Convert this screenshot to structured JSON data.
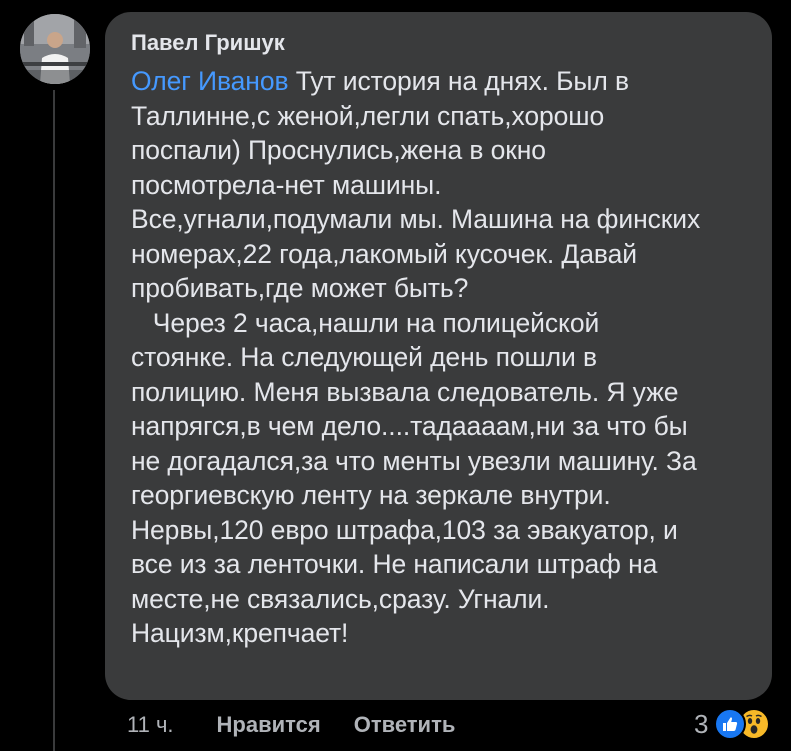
{
  "comment": {
    "author": "Павел Гришук",
    "mention": "Олег Иванов",
    "lines": [
      " Тут история на днях. Был в",
      "Таллинне,с женой,легли спать,хорошо",
      "поспали) Проснулись,жена в окно",
      "посмотрела-нет машины.",
      "Все,угнали,подумали мы. Машина на финских",
      "номерах,22 года,лакомый кусочек. Давай",
      "пробивать,где может быть?",
      "   Через 2 часа,нашли на полицейской",
      "стоянке. На следующей день пошли в",
      "полицию. Меня вызвала следователь. Я уже",
      "напрягся,в чем дело....тадаааам,ни за что бы",
      "не догадался,за что менты увезли машину. За",
      "георгиевскую ленту на зеркале внутри.",
      "Нервы,120 евро штрафа,103 за эвакуатор, и",
      "все из за ленточки. Не написали штраф на",
      "месте,не связались,сразу. Угнали.",
      "Нацизм,крепчает!"
    ]
  },
  "actions": {
    "time": "11 ч.",
    "like": "Нравится",
    "reply": "Ответить"
  },
  "reactions": {
    "count": "3",
    "types": [
      "like-reaction-icon",
      "wow-reaction-icon"
    ]
  },
  "colors": {
    "background": "#000000",
    "bubble": "#3a3b3c",
    "text": "#e4e6eb",
    "mention": "#4599ff",
    "meta": "#b0b3b8",
    "like": "#1877f2",
    "wow": "#f7b928"
  }
}
